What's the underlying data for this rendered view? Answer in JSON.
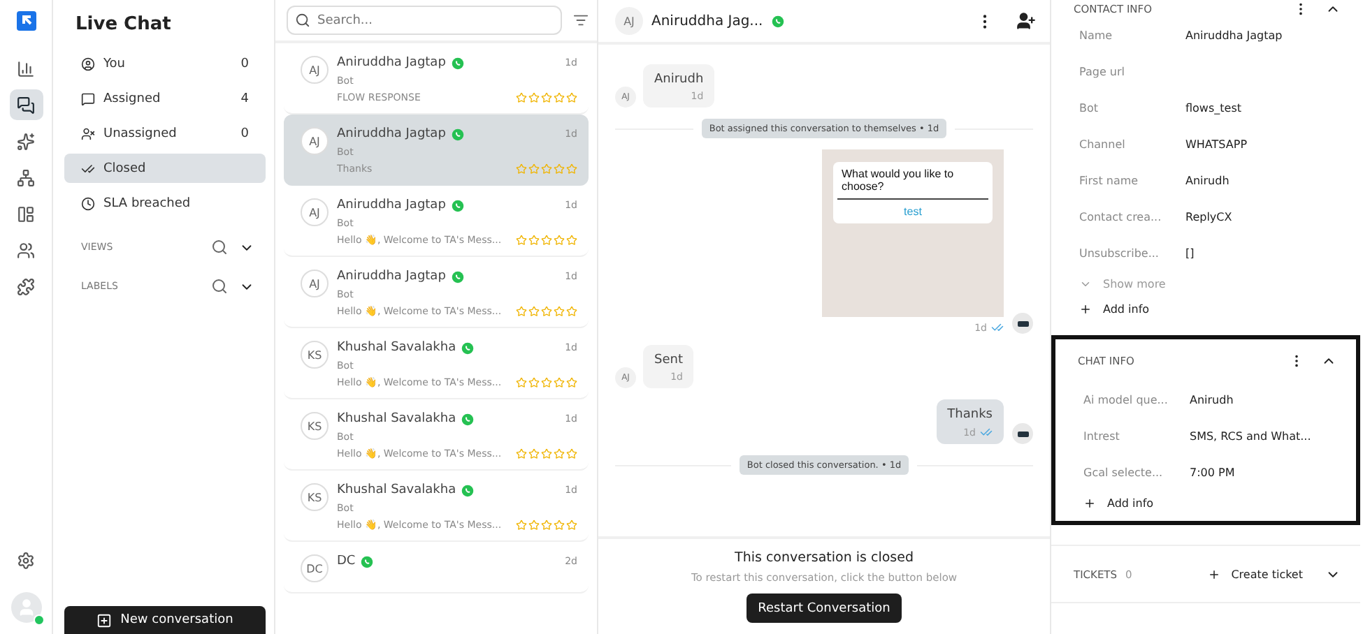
{
  "rail": {
    "items": [
      {
        "selected": false
      },
      {
        "selected": true
      },
      {
        "selected": false
      },
      {
        "selected": false
      },
      {
        "selected": false
      },
      {
        "selected": false
      },
      {
        "selected": false
      }
    ],
    "online": true
  },
  "nav": {
    "title": "Live Chat",
    "items": [
      {
        "kind": "you",
        "label": "You",
        "count": "0",
        "selected": false
      },
      {
        "kind": "assigned",
        "label": "Assigned",
        "count": "4",
        "selected": false
      },
      {
        "kind": "unassigned",
        "label": "Unassigned",
        "count": "0",
        "selected": false
      },
      {
        "kind": "closed",
        "label": "Closed",
        "selected": true
      },
      {
        "kind": "sla",
        "label": "SLA breached",
        "selected": false
      }
    ],
    "sections": [
      {
        "label": "VIEWS"
      },
      {
        "label": "LABELS"
      }
    ],
    "new_button": "New conversation"
  },
  "list": {
    "search": {
      "placeholder": "Search..."
    },
    "conversations": [
      {
        "initials": "AJ",
        "name": "Aniruddha Jagtap",
        "sub": "Bot",
        "preview": "FLOW RESPONSE",
        "time": "1d",
        "stars": 0,
        "selected": false
      },
      {
        "initials": "AJ",
        "name": "Aniruddha Jagtap",
        "sub": "Bot",
        "preview": "Thanks",
        "time": "1d",
        "stars": 0,
        "selected": true
      },
      {
        "initials": "AJ",
        "name": "Aniruddha Jagtap",
        "sub": "Bot",
        "preview": "Hello 👋, Welcome to TA's Mess...",
        "time": "1d",
        "stars": 0,
        "selected": false
      },
      {
        "initials": "AJ",
        "name": "Aniruddha Jagtap",
        "sub": "Bot",
        "preview": "Hello 👋, Welcome to TA's Mess...",
        "time": "1d",
        "stars": 0,
        "selected": false
      },
      {
        "initials": "KS",
        "name": "Khushal Savalakha",
        "sub": "Bot",
        "preview": "Hello 👋, Welcome to TA's Mess...",
        "time": "1d",
        "stars": 0,
        "selected": false
      },
      {
        "initials": "KS",
        "name": "Khushal Savalakha",
        "sub": "Bot",
        "preview": "Hello 👋, Welcome to TA's Mess...",
        "time": "1d",
        "stars": 0,
        "selected": false
      },
      {
        "initials": "KS",
        "name": "Khushal Savalakha",
        "sub": "Bot",
        "preview": "Hello 👋, Welcome to TA's Mess...",
        "time": "1d",
        "stars": 0,
        "selected": false
      },
      {
        "initials": "DC",
        "name": "DC",
        "time": "2d",
        "selected": false
      }
    ]
  },
  "chat": {
    "header": {
      "initials": "AJ",
      "name": "Aniruddha Jag..."
    },
    "messages": [
      {
        "kind": "incoming",
        "initials": "AJ",
        "text": "Anirudh",
        "time": "1d"
      },
      {
        "kind": "event",
        "text": "Bot assigned this conversation to themselves • 1d"
      },
      {
        "kind": "template",
        "question": "What would you like to choose?",
        "option": "test",
        "time": "1d",
        "read": true
      },
      {
        "kind": "incoming",
        "initials": "AJ",
        "text": "Sent",
        "time": "1d"
      },
      {
        "kind": "outgoing",
        "text": "Thanks",
        "time": "1d",
        "read": true
      },
      {
        "kind": "event",
        "text": "Bot closed this conversation. • 1d"
      }
    ],
    "closed": {
      "title": "This conversation is closed",
      "subtitle": "To restart this conversation, click the button below",
      "button": "Restart Conversation"
    }
  },
  "details": {
    "contact": {
      "title": "CONTACT INFO",
      "expanded": true,
      "fields": [
        {
          "label": "Name",
          "value": "Aniruddha Jagtap"
        },
        {
          "label": "Page url"
        },
        {
          "label": "Bot",
          "value": "flows_test"
        },
        {
          "label": "Channel",
          "value": "WHATSAPP"
        },
        {
          "label": "First name",
          "value": "Anirudh"
        },
        {
          "label": "Contact crea...",
          "value": "ReplyCX"
        },
        {
          "label": "Unsubscribe...",
          "value": "[]"
        }
      ],
      "show_more": "Show more",
      "add": "Add info"
    },
    "chat_info": {
      "title": "CHAT INFO",
      "expanded": true,
      "highlighted": true,
      "fields": [
        {
          "label": "Ai model que...",
          "value": "Anirudh"
        },
        {
          "label": "Intrest",
          "value": "SMS, RCS and What..."
        },
        {
          "label": "Gcal selecte...",
          "value": "7:00 PM"
        }
      ],
      "add": "Add info"
    },
    "tickets": {
      "title": "TICKETS",
      "count": "0",
      "create": "Create ticket"
    }
  }
}
